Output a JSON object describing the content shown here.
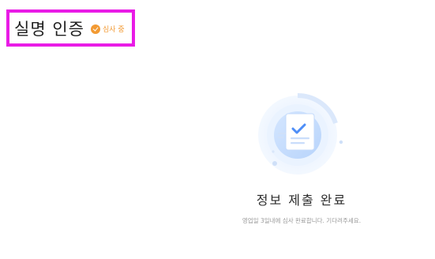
{
  "header": {
    "title": "실명 인증",
    "status_badge": {
      "icon": "check-circle-icon",
      "label": "심사 중",
      "color": "#f29a33"
    },
    "highlight_color": "#e91be6"
  },
  "completion": {
    "illustration_icon": "document-check-icon",
    "title": "정보 제출 완료",
    "description": "영업일 3일내에 심사 완료합니다. 기다려주세요."
  }
}
